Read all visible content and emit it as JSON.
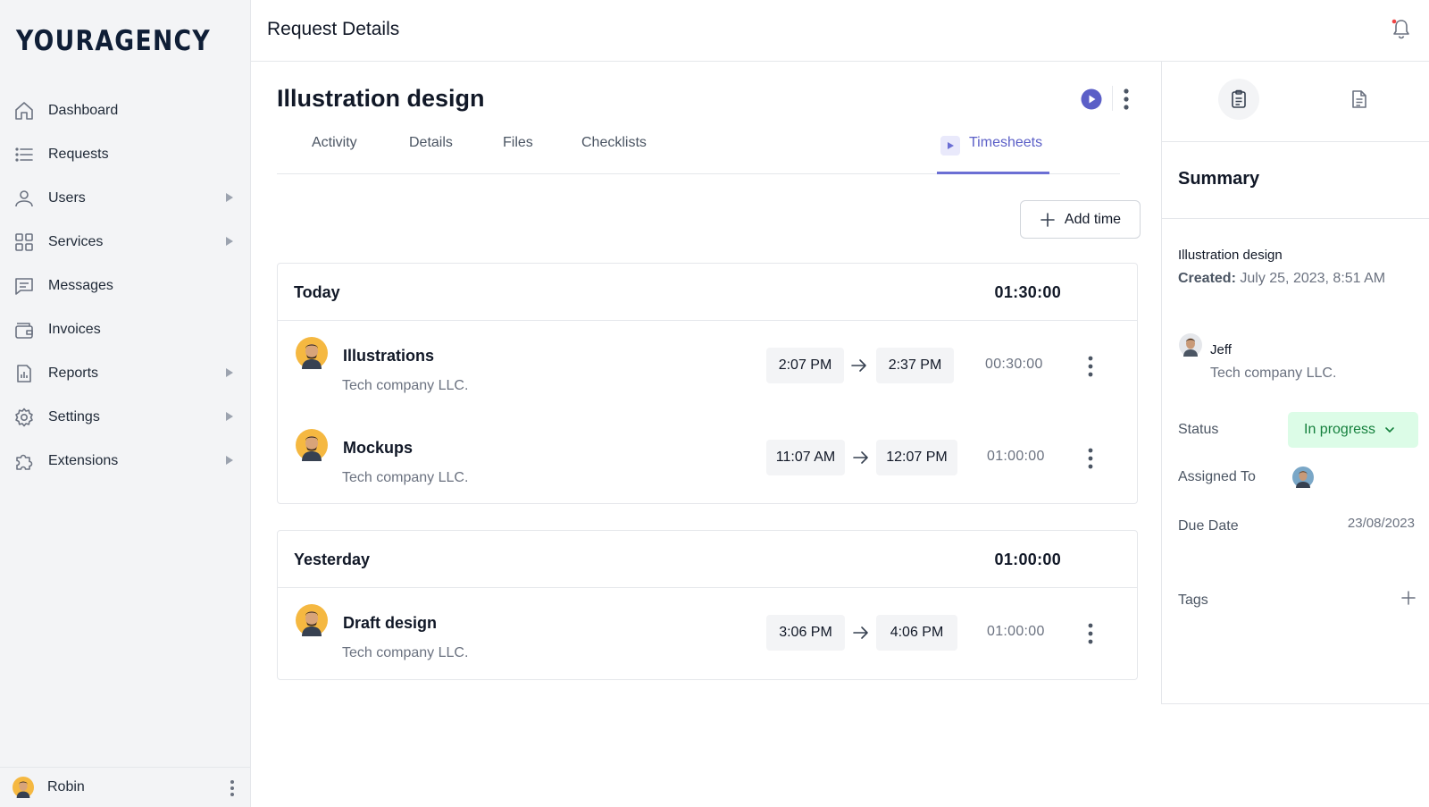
{
  "brand": {
    "logo_text": "YOURAGENCY"
  },
  "sidebar": {
    "items": [
      {
        "label": "Dashboard",
        "icon": "home-icon",
        "has_submenu": false
      },
      {
        "label": "Requests",
        "icon": "list-icon",
        "has_submenu": false
      },
      {
        "label": "Users",
        "icon": "users-icon",
        "has_submenu": true
      },
      {
        "label": "Services",
        "icon": "grid-icon",
        "has_submenu": true
      },
      {
        "label": "Messages",
        "icon": "chat-icon",
        "has_submenu": false
      },
      {
        "label": "Invoices",
        "icon": "wallet-icon",
        "has_submenu": false
      },
      {
        "label": "Reports",
        "icon": "report-icon",
        "has_submenu": true
      },
      {
        "label": "Settings",
        "icon": "gear-icon",
        "has_submenu": true
      },
      {
        "label": "Extensions",
        "icon": "puzzle-icon",
        "has_submenu": true
      }
    ],
    "footer": {
      "user_name": "Robin"
    }
  },
  "header": {
    "title": "Request Details",
    "notification_dot_color": "#ef4444"
  },
  "request": {
    "title": "Illustration design",
    "tabs": [
      {
        "label": "Activity",
        "active": false
      },
      {
        "label": "Details",
        "active": false
      },
      {
        "label": "Files",
        "active": false
      },
      {
        "label": "Checklists",
        "active": false
      },
      {
        "label": "Timesheets",
        "active": true
      }
    ],
    "add_time_label": "Add time"
  },
  "timesheets": [
    {
      "group": "Today",
      "total": "01:30:00",
      "entries": [
        {
          "title": "Illustrations",
          "company": "Tech company LLC.",
          "start": "2:07 PM",
          "end": "2:37 PM",
          "duration": "00:30:00"
        },
        {
          "title": "Mockups",
          "company": "Tech company LLC.",
          "start": "11:07 AM",
          "end": "12:07 PM",
          "duration": "01:00:00"
        }
      ]
    },
    {
      "group": "Yesterday",
      "total": "01:00:00",
      "entries": [
        {
          "title": "Draft design",
          "company": "Tech company LLC.",
          "start": "3:06 PM",
          "end": "4:06 PM",
          "duration": "01:00:00"
        }
      ]
    }
  ],
  "summary": {
    "title": "Summary",
    "request_name": "Illustration design",
    "created_label": "Created:",
    "created_value": "July 25, 2023, 8:51 AM",
    "client_name": "Jeff",
    "client_company": "Tech company LLC.",
    "status_label": "Status",
    "status_value": "In progress",
    "assigned_label": "Assigned To",
    "due_label": "Due Date",
    "due_value": "23/08/2023",
    "tags_label": "Tags"
  },
  "colors": {
    "accent": "#5b5fc7",
    "status_bg": "#dcfce7",
    "status_text": "#15803d"
  }
}
